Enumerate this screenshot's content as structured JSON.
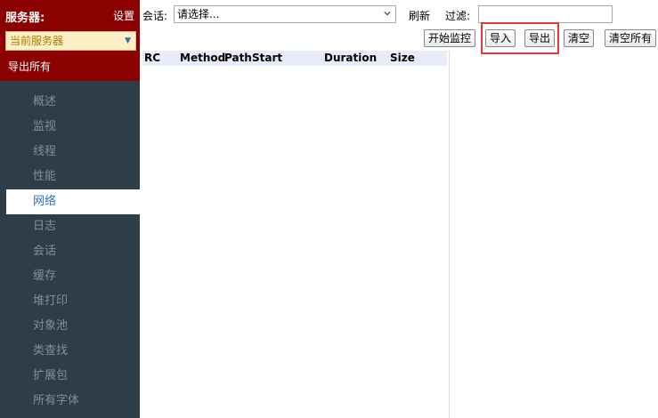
{
  "sidebar": {
    "title": "服务器:",
    "settings_label": "设置",
    "server_select": "当前服务器",
    "export_all": "导出所有",
    "nav": [
      {
        "label": "概述",
        "active": false
      },
      {
        "label": "监视",
        "active": false
      },
      {
        "label": "线程",
        "active": false
      },
      {
        "label": "性能",
        "active": false
      },
      {
        "label": "网络",
        "active": true
      },
      {
        "label": "日志",
        "active": false
      },
      {
        "label": "会话",
        "active": false
      },
      {
        "label": "缓存",
        "active": false
      },
      {
        "label": "堆打印",
        "active": false
      },
      {
        "label": "对象池",
        "active": false
      },
      {
        "label": "类查找",
        "active": false
      },
      {
        "label": "扩展包",
        "active": false
      },
      {
        "label": "所有字体",
        "active": false
      }
    ]
  },
  "toolbar": {
    "session_label": "会话:",
    "session_value": "请选择...",
    "refresh_label": "刷新",
    "filter_label": "过滤:",
    "filter_value": "",
    "start_monitor_label": "开始监控",
    "import_label": "导入",
    "export_label": "导出",
    "clear_label": "清空",
    "clear_all_label": "清空所有"
  },
  "table": {
    "columns": [
      "RC",
      "Method",
      "Path",
      "Start",
      "Duration",
      "Size"
    ],
    "rows": []
  },
  "colors": {
    "header_red": "#8b0000",
    "sidebar_bg": "#2e3e48",
    "active_nav_text": "#2a6fb4",
    "highlight": "#e53935"
  }
}
